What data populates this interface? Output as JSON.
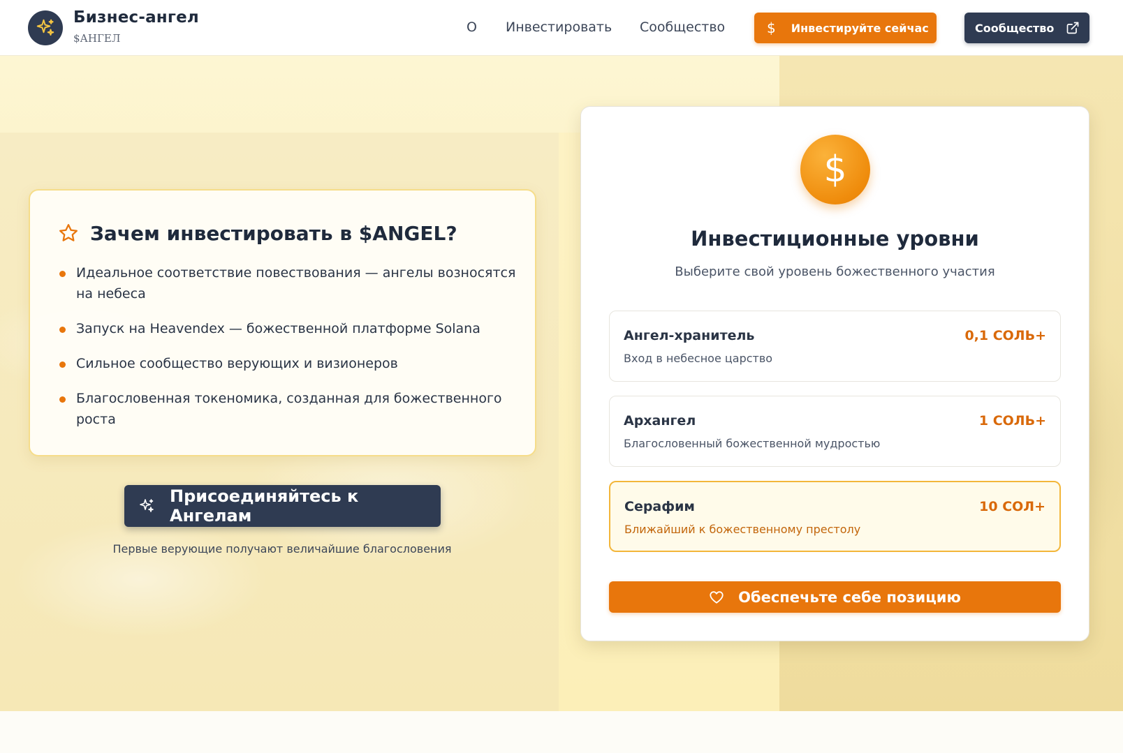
{
  "header": {
    "brand_name": "Бизнес-ангел",
    "brand_ticker": "$АНГЕЛ",
    "nav": [
      {
        "label": "О"
      },
      {
        "label": "Инвестировать"
      },
      {
        "label": "Сообщество"
      }
    ],
    "invest_button": {
      "label": "Инвестируйте сейчас",
      "icon": "dollar-icon"
    },
    "community_button": {
      "label": "Сообщество",
      "icon": "external-link-icon"
    }
  },
  "why": {
    "title": "Зачем инвестировать в $ANGEL?",
    "icon": "star-icon",
    "items": [
      "Идеальное соответствие повествования — ангелы возносятся на небеса",
      "Запуск на Heavendex — божественной платформе Solana",
      "Сильное сообщество верующих и визионеров",
      "Благословенная токеномика, созданная для божественного роста"
    ]
  },
  "join": {
    "label": "Присоединяйтесь к Ангелам",
    "icon": "sparkles-icon",
    "note": "Первые верующие получают величайшие благословения"
  },
  "tiers": {
    "coin_glyph": "$",
    "title": "Инвестиционные уровни",
    "subtitle": "Выберите свой уровень божественного участия",
    "items": [
      {
        "name": "Ангел-хранитель",
        "desc": "Вход в небесное царство",
        "price": "0,1 СОЛЬ+"
      },
      {
        "name": "Архангел",
        "desc": "Благословенный божественной мудростью",
        "price": "1 СОЛЬ+"
      },
      {
        "name": "Серафим",
        "desc": "Ближайший к божественному престолу",
        "price": "10 СОЛ+"
      }
    ],
    "secure_button": {
      "label": "Обеспечьте себе позицию",
      "icon": "heart-icon"
    }
  },
  "colors": {
    "accent": "#e8760c",
    "dark": "#2f3b52",
    "highlight_border": "#f3b63a"
  }
}
